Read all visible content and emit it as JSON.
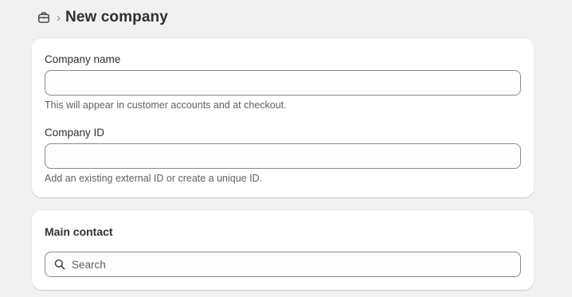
{
  "header": {
    "icon": "briefcase-icon",
    "separator": "›",
    "title": "New company"
  },
  "company_card": {
    "company_name": {
      "label": "Company name",
      "value": "",
      "help": "This will appear in customer accounts and at checkout."
    },
    "company_id": {
      "label": "Company ID",
      "value": "",
      "help": "Add an existing external ID or create a unique ID."
    }
  },
  "main_contact": {
    "title": "Main contact",
    "search": {
      "icon": "search-icon",
      "placeholder": "Search",
      "value": ""
    }
  }
}
